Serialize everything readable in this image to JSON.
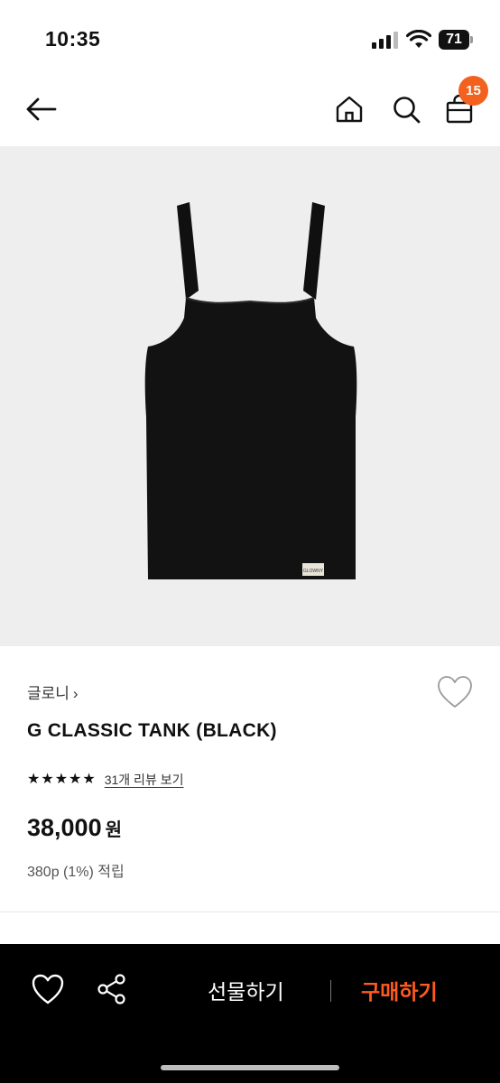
{
  "status": {
    "time": "10:35",
    "battery": "71"
  },
  "nav": {
    "cart_count": "15"
  },
  "product": {
    "brand": "글로니",
    "name": "G CLASSIC TANK (BLACK)",
    "rating": 5,
    "review_link": "31개 리뷰 보기",
    "price": "38,000",
    "currency": "원",
    "points": "380p (1%) 적립",
    "tag_text": "GLOWNY"
  },
  "actions": {
    "gift": "선물하기",
    "buy": "구매하기"
  },
  "colors": {
    "accent": "#f2611d",
    "buy_text": "#ff5a1f",
    "bottom_bar": "#000000",
    "image_bg": "#eeeeee"
  }
}
